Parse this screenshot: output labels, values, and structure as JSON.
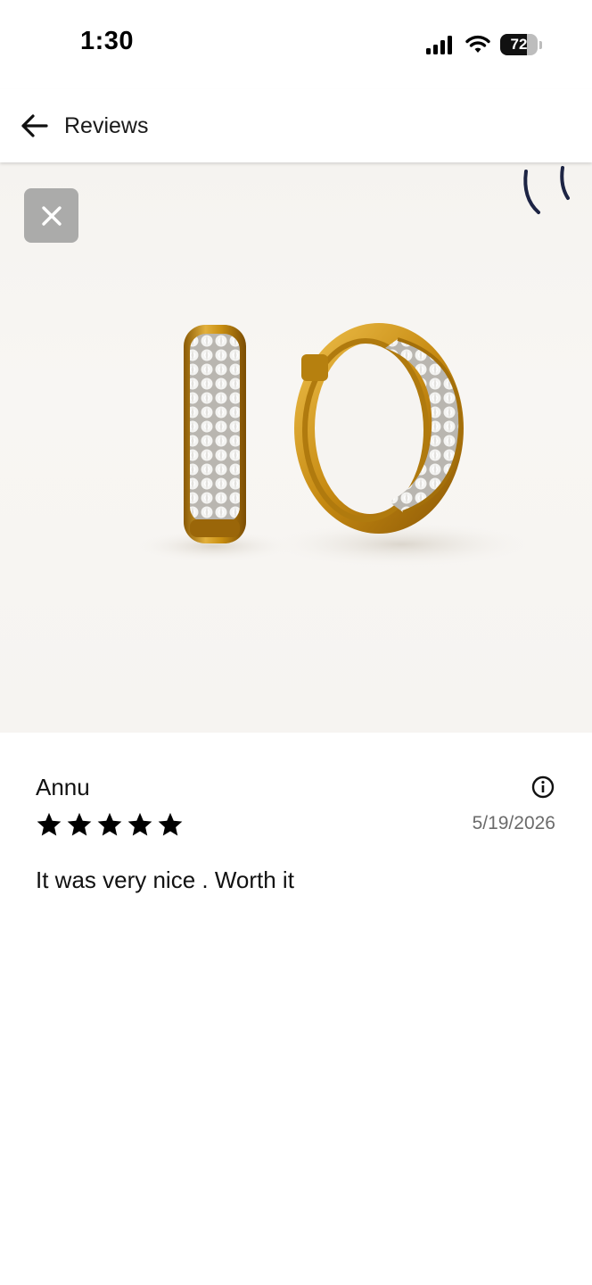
{
  "status_bar": {
    "time": "1:30",
    "battery_level": "72",
    "icons": [
      "signal-icon",
      "wifi-icon",
      "battery-icon"
    ]
  },
  "header": {
    "title": "Reviews",
    "back_icon": "arrow-left-icon"
  },
  "photo": {
    "subject": "gold pave hoop earrings",
    "close_icon": "close-icon"
  },
  "review": {
    "name": "Annu",
    "rating": 5,
    "date": "5/19/2026",
    "text": "It was very nice . Worth it",
    "info_icon": "info-icon"
  },
  "colors": {
    "gold": "#c7921c",
    "star": "#000000",
    "date_text": "#6b6b6b"
  }
}
